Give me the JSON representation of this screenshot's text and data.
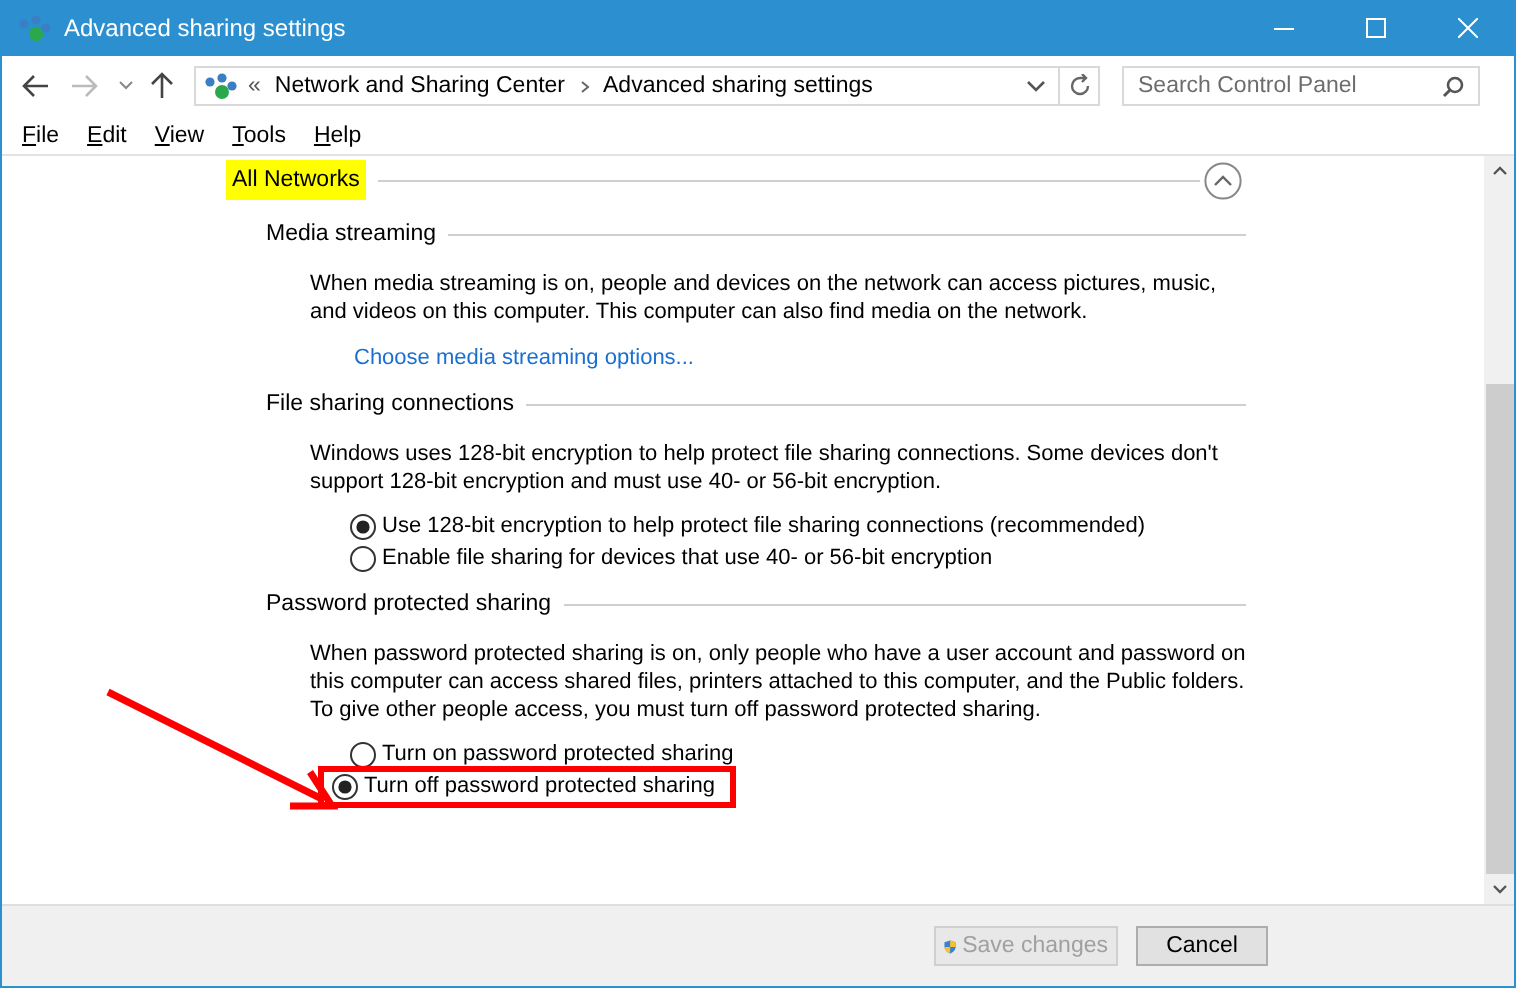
{
  "window": {
    "title": "Advanced sharing settings"
  },
  "address_bar": {
    "breadcrumb": [
      "Network and Sharing Center",
      "Advanced sharing settings"
    ],
    "overflow": "«"
  },
  "search": {
    "placeholder": "Search Control Panel"
  },
  "menu": [
    "File",
    "Edit",
    "View",
    "Tools",
    "Help"
  ],
  "section": {
    "title": "All Networks",
    "highlighted": true,
    "expanded": true,
    "groups": [
      {
        "title": "Media streaming",
        "description": "When media streaming is on, people and devices on the network can access pictures, music, and videos on this computer. This computer can also find media on the network.",
        "link": "Choose media streaming options..."
      },
      {
        "title": "File sharing connections",
        "description": "Windows uses 128-bit encryption to help protect file sharing connections. Some devices don't support 128-bit encryption and must use 40- or 56-bit encryption.",
        "options": [
          {
            "label": "Use 128-bit encryption to help protect file sharing connections (recommended)",
            "selected": true,
            "annotated": false
          },
          {
            "label": "Enable file sharing for devices that use 40- or 56-bit encryption",
            "selected": false,
            "annotated": false
          }
        ]
      },
      {
        "title": "Password protected sharing",
        "description": "When password protected sharing is on, only people who have a user account and password on this computer can access shared files, printers attached to this computer, and the Public folders. To give other people access, you must turn off password protected sharing.",
        "options": [
          {
            "label": "Turn on password protected sharing",
            "selected": false,
            "annotated": false
          },
          {
            "label": "Turn off password protected sharing",
            "selected": true,
            "annotated": true
          }
        ]
      }
    ]
  },
  "buttons": [
    {
      "label": "Save changes",
      "disabled": true,
      "shield": true
    },
    {
      "label": "Cancel",
      "disabled": false,
      "shield": false
    }
  ]
}
